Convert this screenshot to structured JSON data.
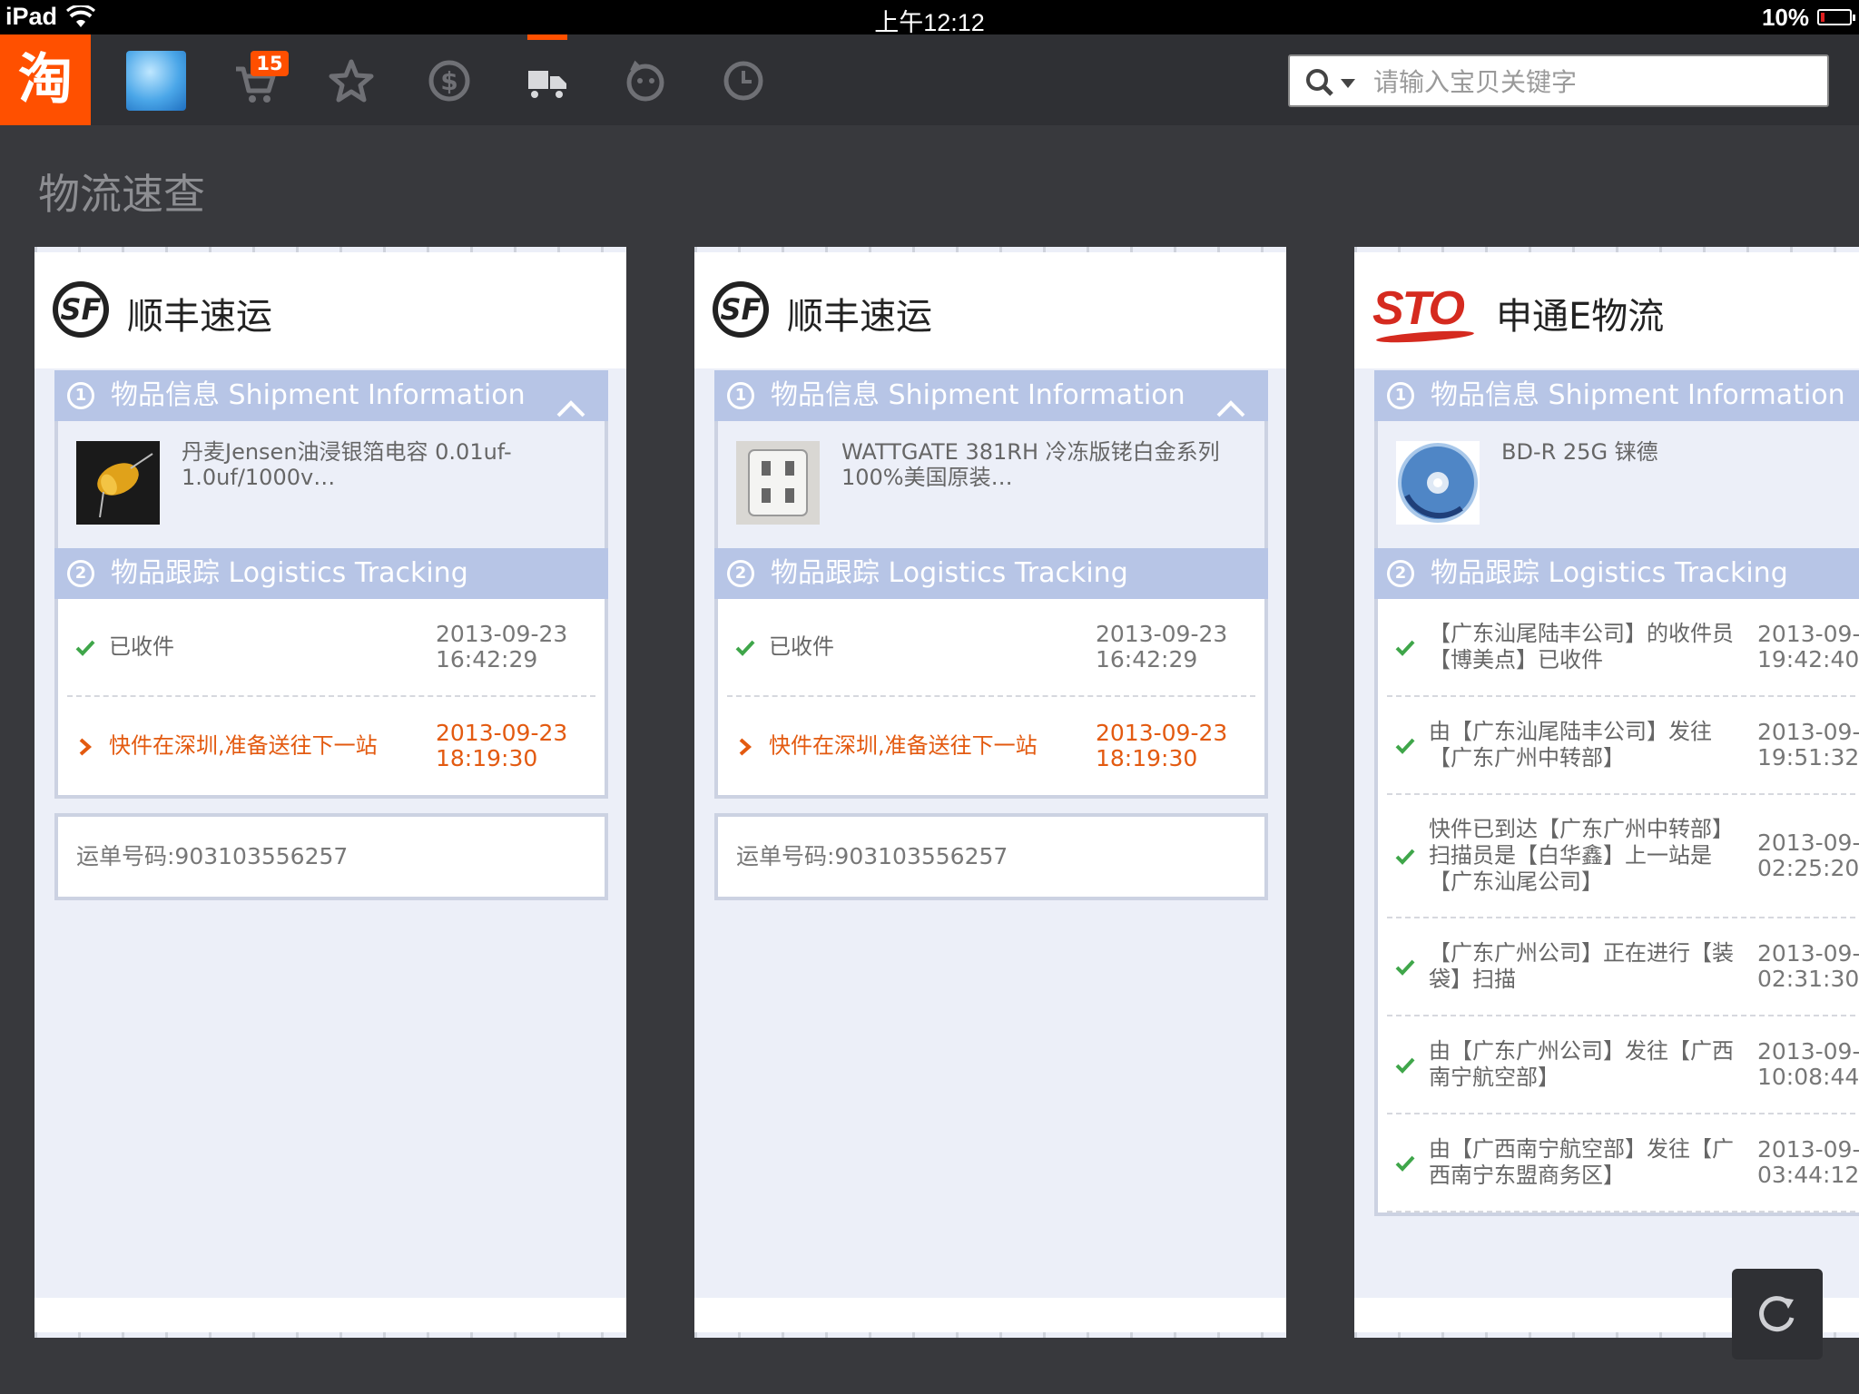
{
  "status_bar": {
    "device": "iPad",
    "time": "上午12:12",
    "battery": "10%"
  },
  "toolbar": {
    "logo": "淘",
    "cart_badge": "15",
    "icons": [
      "avatar",
      "cart-icon",
      "favorites-star-icon",
      "coin-icon",
      "logistics-truck-icon",
      "pet-icon",
      "history-clock-icon"
    ],
    "active": "logistics-truck-icon",
    "accent": "#ff5000"
  },
  "search": {
    "placeholder": "请输入宝贝关键字"
  },
  "page": {
    "title": "物流速查"
  },
  "cards": [
    {
      "carrier": "顺丰速运",
      "logo_text": "SF",
      "section1": "物品信息 Shipment Information",
      "product": "丹麦Jensen油浸银箔电容 0.01uf-1.0uf/1000v…",
      "section2": "物品跟踪 Logistics Tracking",
      "tracking": [
        {
          "text": "已收件",
          "time": "2013-09-23\n16:42:29",
          "status": "done"
        },
        {
          "text": "快件在深圳,准备送往下一站",
          "time": "2013-09-23\n18:19:30",
          "status": "current"
        }
      ],
      "waybill": "运单号码:903103556257"
    },
    {
      "carrier": "顺丰速运",
      "logo_text": "SF",
      "section1": "物品信息 Shipment Information",
      "product": "WATTGATE 381RH 冷冻版铑白金系列100%美国原装…",
      "section2": "物品跟踪 Logistics Tracking",
      "tracking": [
        {
          "text": "已收件",
          "time": "2013-09-23\n16:42:29",
          "status": "done"
        },
        {
          "text": "快件在深圳,准备送往下一站",
          "time": "2013-09-23\n18:19:30",
          "status": "current"
        }
      ],
      "waybill": "运单号码:903103556257"
    },
    {
      "carrier": "申通E物流",
      "logo_text": "STO",
      "section1": "物品信息 Shipment Information",
      "product": "BD-R 25G 铼德",
      "section2": "物品跟踪 Logistics Tracking",
      "tracking": [
        {
          "text": "【广东汕尾陆丰公司】的收件员【博美点】已收件",
          "time": "2013-09-\n19:42:40",
          "status": "done"
        },
        {
          "text": "由【广东汕尾陆丰公司】发往【广东广州中转部】",
          "time": "2013-09-\n19:51:32",
          "status": "done"
        },
        {
          "text": "快件已到达【广东广州中转部】扫描员是【白华鑫】上一站是【广东汕尾公司】",
          "time": "2013-09-\n02:25:20",
          "status": "done"
        },
        {
          "text": "【广东广州公司】正在进行【装袋】扫描",
          "time": "2013-09-\n02:31:30",
          "status": "done"
        },
        {
          "text": "由【广东广州公司】发往【广西南宁航空部】",
          "time": "2013-09-\n10:08:44",
          "status": "done"
        },
        {
          "text": "由【广西南宁航空部】发往【广西南宁东盟商务区】",
          "time": "2013-09-\n03:44:12",
          "status": "done"
        }
      ]
    }
  ]
}
